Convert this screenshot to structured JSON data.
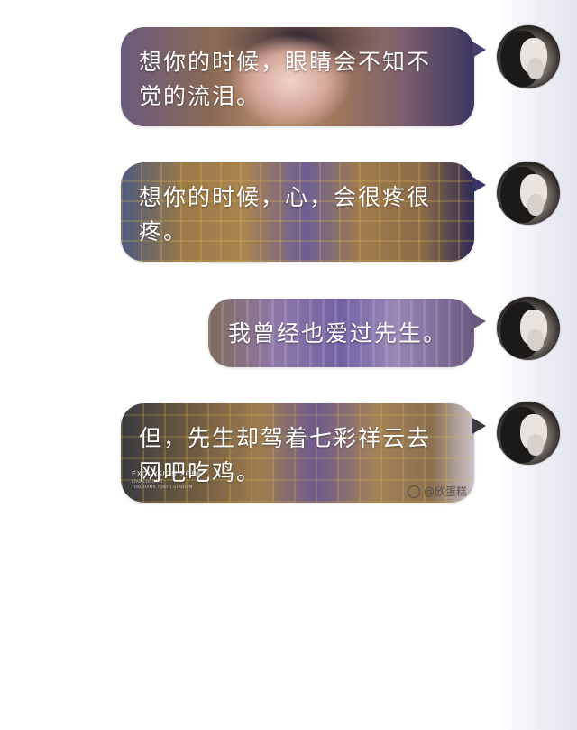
{
  "messages": [
    {
      "text": "想你的时候，眼睛会不知不觉的流泪。"
    },
    {
      "text": "想你的时候，心，会很疼很疼。"
    },
    {
      "text": "我曾经也爱过先生。"
    },
    {
      "text": "但，先生却驾着七彩祥云去网吧吃鸡。"
    }
  ],
  "watermarks": {
    "left_title": "EXOLUSION ZONE",
    "left_sub_1": "LIVE CONCERT",
    "left_sub_2": "YOKOHAMA TOKYO STADIUM",
    "right": "@欣蛋糕"
  },
  "colors": {
    "background": "#ffffff",
    "text": "#ffffff",
    "side_shade": "#e4e4ef"
  }
}
